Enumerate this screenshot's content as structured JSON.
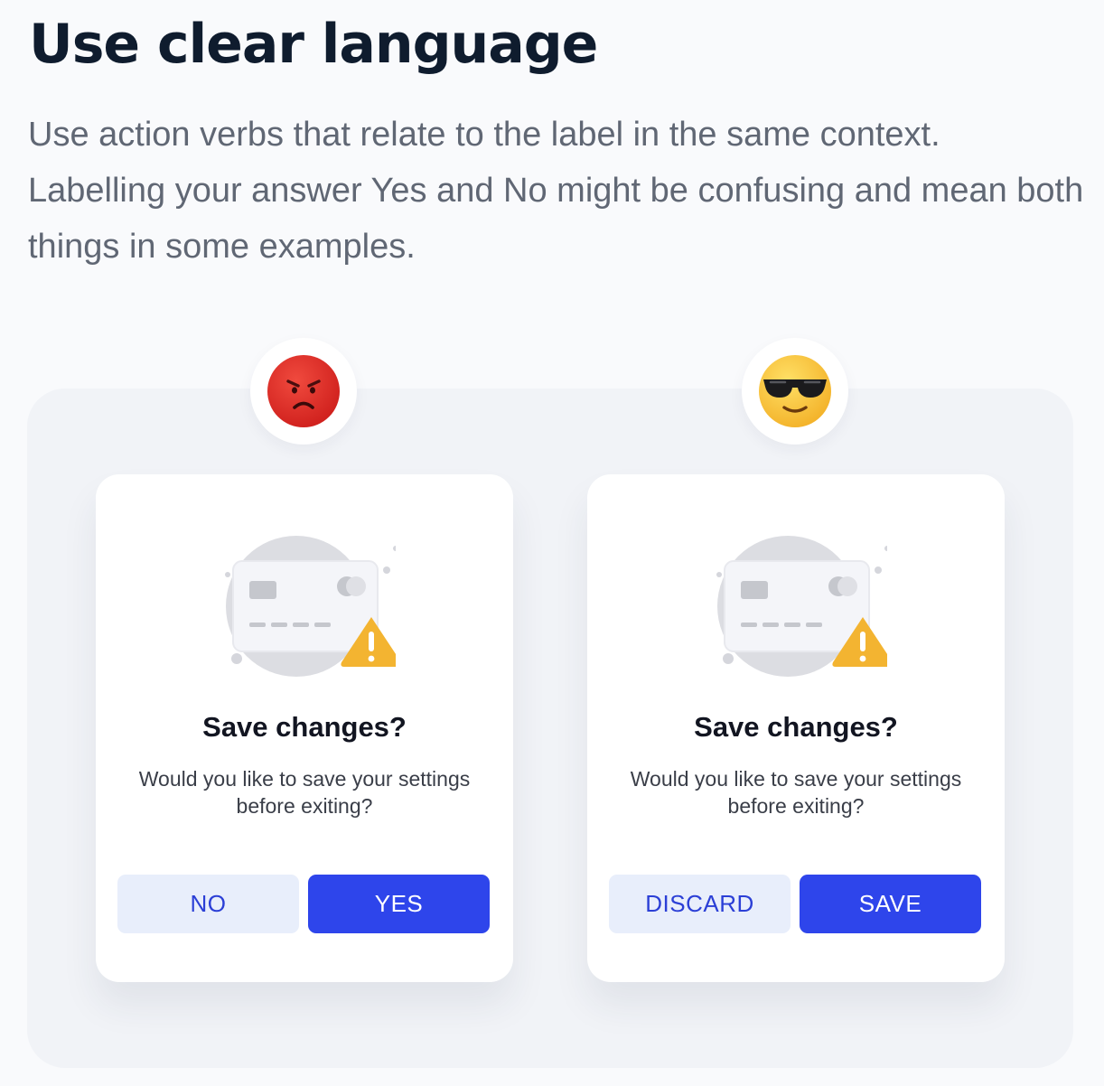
{
  "page": {
    "headline": "Use clear language",
    "lede": "Use action verbs that relate to the label in the same context. Labelling your answer Yes and No might be confusing and mean both things in some examples."
  },
  "examples": [
    {
      "verdict_icon": "angry-face-icon",
      "dialog": {
        "title": "Save changes?",
        "body": "Would you like to save your settings before exiting?",
        "secondary_label": "NO",
        "primary_label": "YES"
      }
    },
    {
      "verdict_icon": "sunglasses-face-icon",
      "dialog": {
        "title": "Save changes?",
        "body": "Would you like to save your settings before exiting?",
        "secondary_label": "DISCARD",
        "primary_label": "SAVE"
      }
    }
  ],
  "colors": {
    "primary": "#2e45eb",
    "secondary_bg": "#e8eefb",
    "secondary_text": "#2b3fd6",
    "panel_bg": "#f1f3f7",
    "warning": "#f3b431"
  }
}
